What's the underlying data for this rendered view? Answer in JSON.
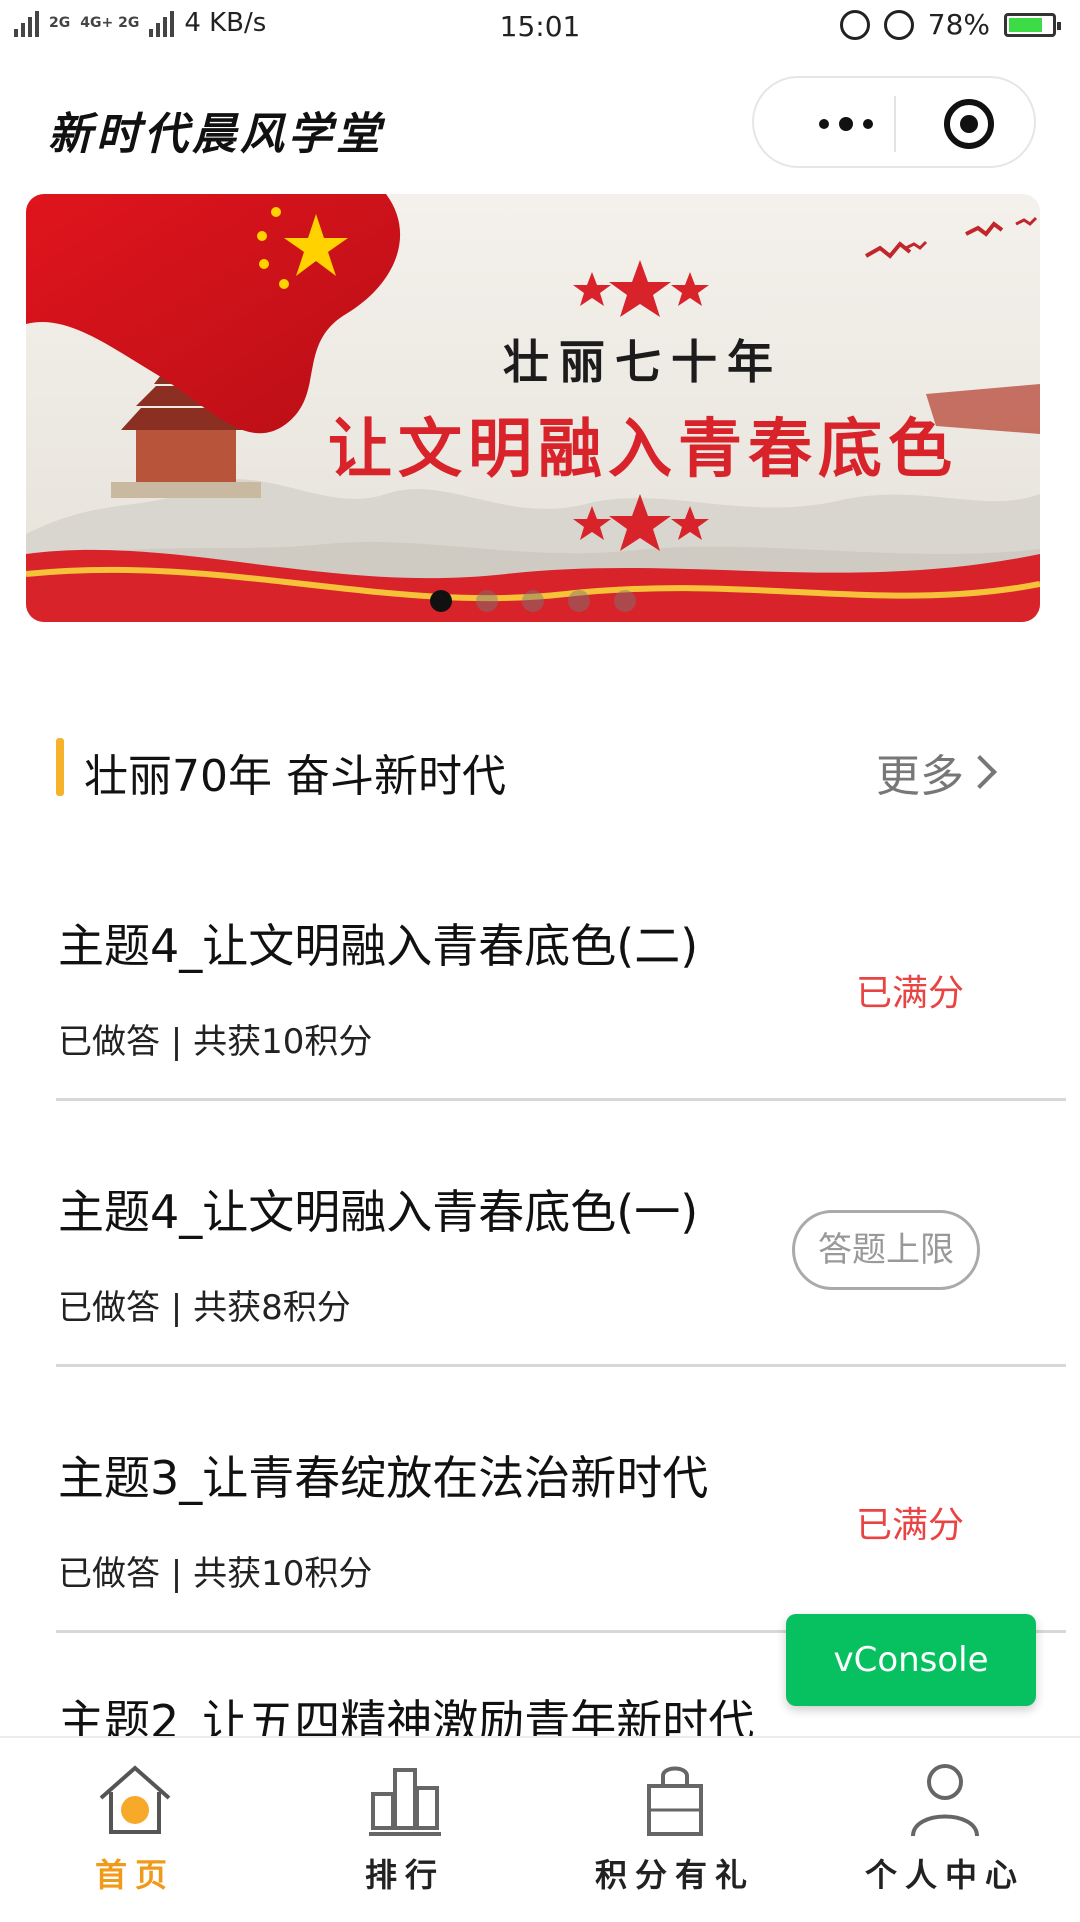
{
  "status_bar": {
    "network_left": "2G",
    "network_mid": "4G+ 2G",
    "speed": "4 KB/s",
    "time": "15:01",
    "battery": "78%",
    "battery_level": 0.78
  },
  "nav": {
    "title": "新时代晨风学堂"
  },
  "banner": {
    "line1": "壮丽七十年",
    "line2": "让文明融入青春底色",
    "slide_count": 5,
    "active_slide": 1
  },
  "section": {
    "title": "壮丽70年 奋斗新时代",
    "more": "更多"
  },
  "items": [
    {
      "title": "主题4_让文明融入青春底色(二)",
      "sub": "已做答 | 共获10积分",
      "status": "已满分",
      "status_style": "text",
      "status_color": "#e84444"
    },
    {
      "title": "主题4_让文明融入青春底色(一)",
      "sub": "已做答 | 共获8积分",
      "status": "答题上限",
      "status_style": "pill",
      "status_color": "#999999"
    },
    {
      "title": "主题3_让青春绽放在法治新时代",
      "sub": "已做答 | 共获10积分",
      "status": "已满分",
      "status_style": "text",
      "status_color": "#e84444"
    },
    {
      "title": "主题2_让五四精神激励青年新时代"
    }
  ],
  "vconsole": {
    "label": "vConsole"
  },
  "tabs": [
    {
      "label": "首页",
      "icon": "home-icon",
      "active": true
    },
    {
      "label": "排行",
      "icon": "ranking-icon",
      "active": false
    },
    {
      "label": "积分有礼",
      "icon": "gift-bag-icon",
      "active": false
    },
    {
      "label": "个人中心",
      "icon": "user-icon",
      "active": false
    }
  ],
  "colors": {
    "accent": "#f7b22b",
    "active_tab": "#f09a1a",
    "full_score": "#e84444",
    "vconsole": "#07c160",
    "flag_red": "#d8232a"
  }
}
